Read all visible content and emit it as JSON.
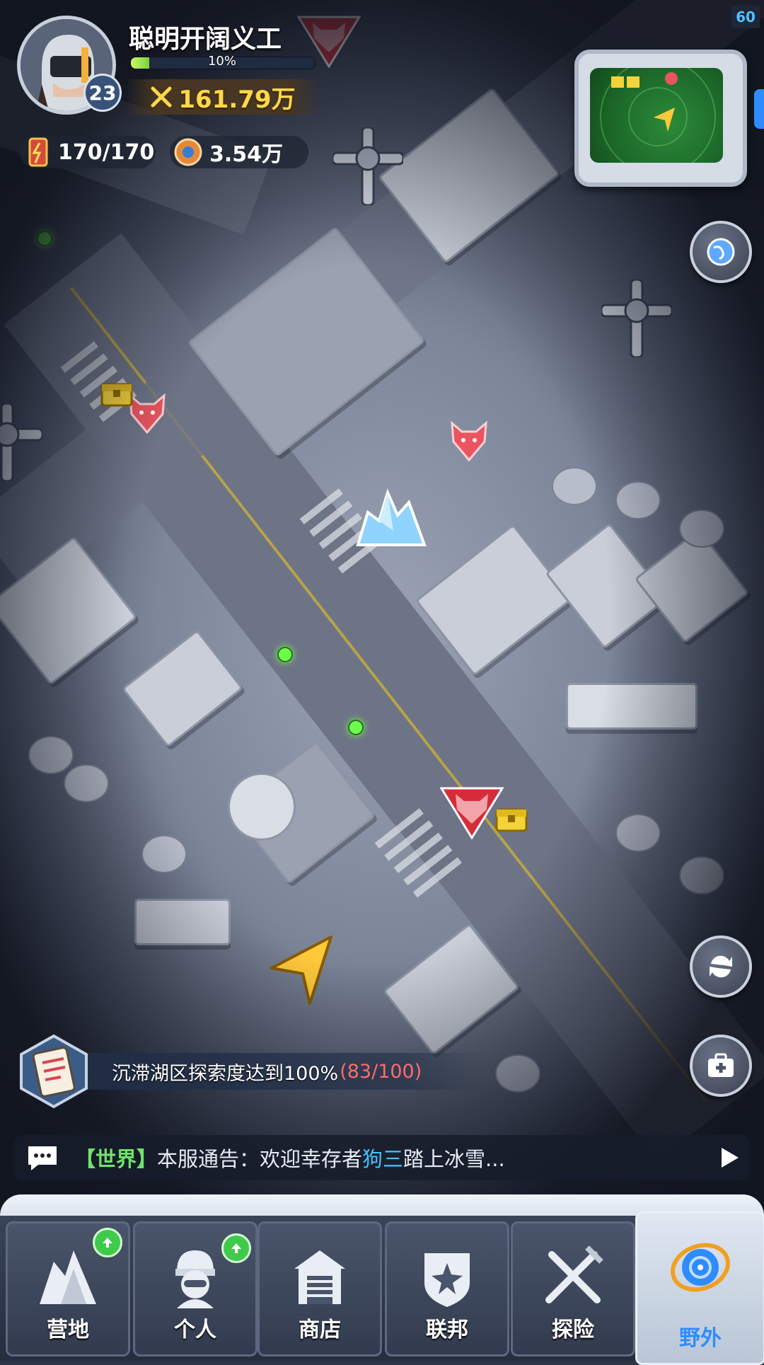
{
  "hud": {
    "fps": "60",
    "player_name": "聪明开阔义工",
    "level": "23",
    "exp_percent_label": "10%",
    "exp_fraction": 0.1,
    "power": "161.79万",
    "stamina": "170/170",
    "currency": "3.54万"
  },
  "quest": {
    "text": "沉滞湖区探索度达到100%",
    "count": "(83/100)"
  },
  "chat": {
    "channel": "【世界】",
    "prefix": "本服通告：欢迎幸存者",
    "name": "狗三",
    "suffix": "踏上冰雪..."
  },
  "nav": {
    "items": [
      {
        "label": "营地",
        "icon": "camp-icon",
        "badge": true
      },
      {
        "label": "个人",
        "icon": "survivor-icon",
        "badge": true
      },
      {
        "label": "商店",
        "icon": "shop-icon",
        "badge": false
      },
      {
        "label": "联邦",
        "icon": "federation-icon",
        "badge": false
      },
      {
        "label": "探险",
        "icon": "expedition-icon",
        "badge": false
      },
      {
        "label": "野外",
        "icon": "wild-icon",
        "badge": false,
        "active": true
      }
    ]
  },
  "side_buttons": [
    "world-map-icon",
    "refresh-icon",
    "heal-icon"
  ],
  "colors": {
    "power_gold": "#ffd84a",
    "chat_channel": "#6fe36a",
    "chat_name": "#42c6ff",
    "quest_count": "#ff6b6b",
    "active_nav": "#2f8cff"
  }
}
